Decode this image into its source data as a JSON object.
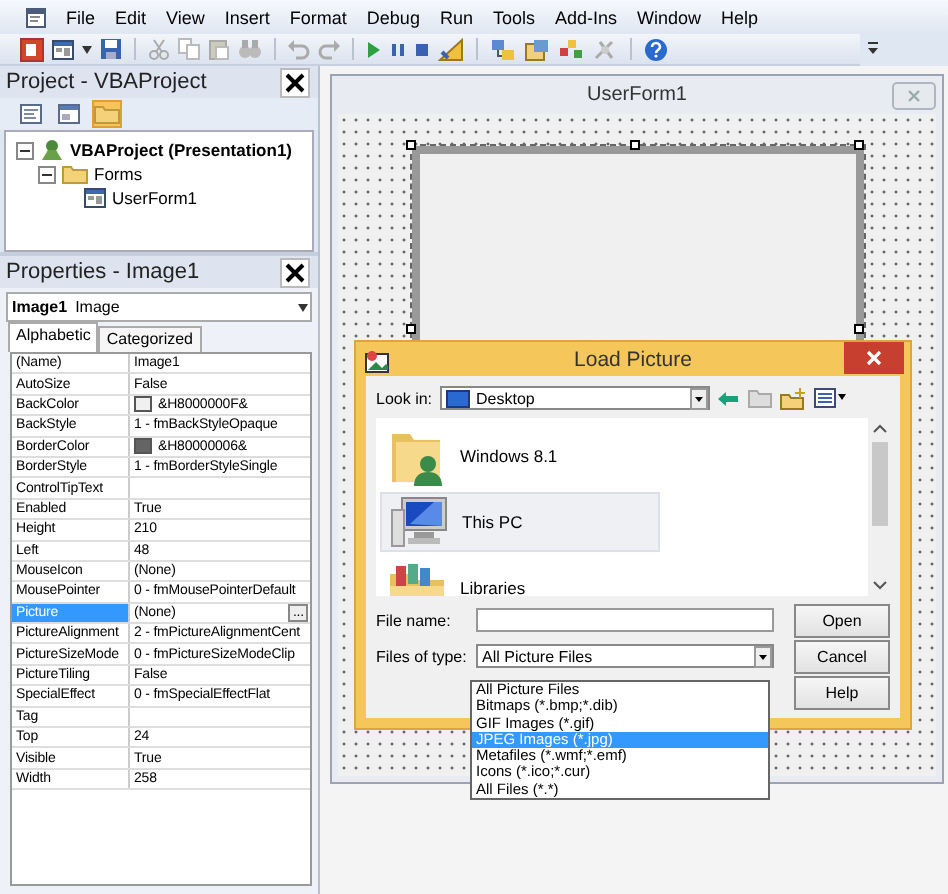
{
  "menu": [
    {
      "label": "File"
    },
    {
      "label": "Edit"
    },
    {
      "label": "View"
    },
    {
      "label": "Insert"
    },
    {
      "label": "Format"
    },
    {
      "label": "Debug"
    },
    {
      "label": "Run"
    },
    {
      "label": "Tools"
    },
    {
      "label": "Add-Ins"
    },
    {
      "label": "Window"
    },
    {
      "label": "Help"
    }
  ],
  "project": {
    "title": "Project - VBAProject",
    "toolbar": [
      {
        "kind": "code",
        "pressed": false
      },
      {
        "kind": "object",
        "pressed": false
      },
      {
        "kind": "folders",
        "pressed": true
      }
    ],
    "tree": [
      {
        "label": "VBAProject (Presentation1)",
        "kind": "project",
        "expanded": true,
        "children": [
          {
            "label": "Forms",
            "kind": "folder",
            "expanded": true,
            "children": [
              {
                "label": "UserForm1",
                "kind": "form"
              }
            ]
          }
        ]
      }
    ]
  },
  "properties": {
    "title": "Properties - Image1",
    "object_name": "Image1",
    "object_type": "Image",
    "tabs": [
      {
        "label": "Alphabetic",
        "selected": true
      },
      {
        "label": "Categorized",
        "selected": false
      }
    ],
    "rows": [
      {
        "name": "(Name)",
        "value": "Image1",
        "selected": false
      },
      {
        "name": "AutoSize",
        "value": "False",
        "selected": false
      },
      {
        "name": "BackColor",
        "value": "&H8000000F&",
        "color": "#f0f0f0",
        "selected": false
      },
      {
        "name": "BackStyle",
        "value": "1 - fmBackStyleOpaque",
        "selected": false
      },
      {
        "name": "BorderColor",
        "value": "&H80000006&",
        "color": "#646464",
        "selected": false
      },
      {
        "name": "BorderStyle",
        "value": "1 - fmBorderStyleSingle",
        "selected": false
      },
      {
        "name": "ControlTipText",
        "selected": false
      },
      {
        "name": "Enabled",
        "value": "True",
        "selected": false
      },
      {
        "name": "Height",
        "value": "210",
        "selected": false
      },
      {
        "name": "Left",
        "value": "48",
        "selected": false
      },
      {
        "name": "MouseIcon",
        "value": "(None)",
        "selected": false
      },
      {
        "name": "MousePointer",
        "value": "0 - fmMousePointerDefault",
        "selected": false
      },
      {
        "name": "Picture",
        "value": "(None)",
        "button": "...",
        "selected": true
      },
      {
        "name": "PictureAlignment",
        "value": "2 - fmPictureAlignmentCent",
        "selected": false
      },
      {
        "name": "PictureSizeMode",
        "value": "0 - fmPictureSizeModeClip",
        "selected": false
      },
      {
        "name": "PictureTiling",
        "value": "False",
        "selected": false
      },
      {
        "name": "SpecialEffect",
        "value": "0 - fmSpecialEffectFlat",
        "selected": false
      },
      {
        "name": "Tag",
        "selected": false
      },
      {
        "name": "Top",
        "value": "24",
        "selected": false
      },
      {
        "name": "Visible",
        "value": "True",
        "selected": false
      },
      {
        "name": "Width",
        "value": "258",
        "selected": false
      }
    ]
  },
  "userform": {
    "title": "UserForm1"
  },
  "dialog": {
    "title": "Load Picture",
    "look_in_label": "Look in:",
    "look_in": "Desktop",
    "items": [
      {
        "label": "Windows 8.1",
        "kind": "user",
        "selected": false
      },
      {
        "label": "This PC",
        "kind": "computer",
        "selected": true
      },
      {
        "label": "Libraries",
        "kind": "libraries",
        "selected": false
      }
    ],
    "file_name_label": "File name:",
    "file_type_label": "Files of type:",
    "file_type": "All Picture Files",
    "buttons": [
      {
        "label": "Open"
      },
      {
        "label": "Cancel"
      },
      {
        "label": "Help"
      }
    ],
    "type_options": [
      {
        "label": "All Picture Files",
        "selected": false
      },
      {
        "label": "Bitmaps (*.bmp;*.dib)",
        "selected": false
      },
      {
        "label": "GIF Images (*.gif)",
        "selected": false
      },
      {
        "label": "JPEG Images (*.jpg)",
        "selected": true
      },
      {
        "label": "Metafiles (*.wmf;*.emf)",
        "selected": false
      },
      {
        "label": "Icons (*.ico;*.cur)",
        "selected": false
      },
      {
        "label": "All Files (*.*)",
        "selected": false
      }
    ]
  }
}
